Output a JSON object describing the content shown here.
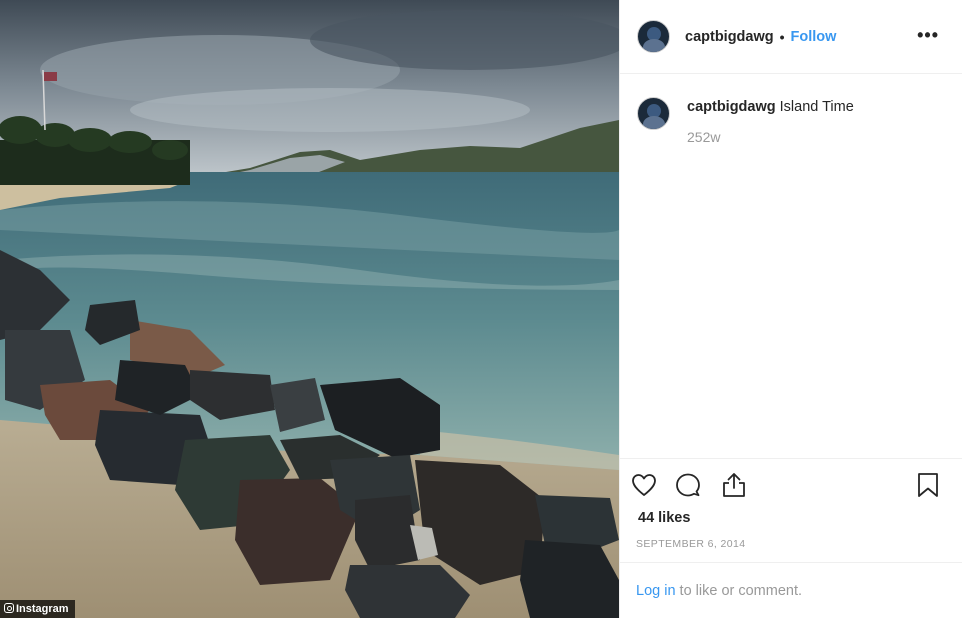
{
  "post": {
    "username": "captbigdawg",
    "separator": "•",
    "follow_label": "Follow",
    "more_label": "•••",
    "caption_username": "captbigdawg",
    "caption_text": "Island Time",
    "time_ago": "252w",
    "likes": "44 likes",
    "date": "SEPTEMBER 6, 2014",
    "login_link": "Log in",
    "login_suffix": " to like or comment."
  },
  "photo": {
    "watermark": "Instagram"
  },
  "icons": {
    "like": "heart-icon",
    "comment": "comment-icon",
    "share": "share-icon",
    "save": "bookmark-icon",
    "more": "more-options-icon"
  },
  "colors": {
    "link_blue": "#3897f0",
    "text_primary": "#262626",
    "text_secondary": "#999999",
    "divider": "#efefef"
  }
}
